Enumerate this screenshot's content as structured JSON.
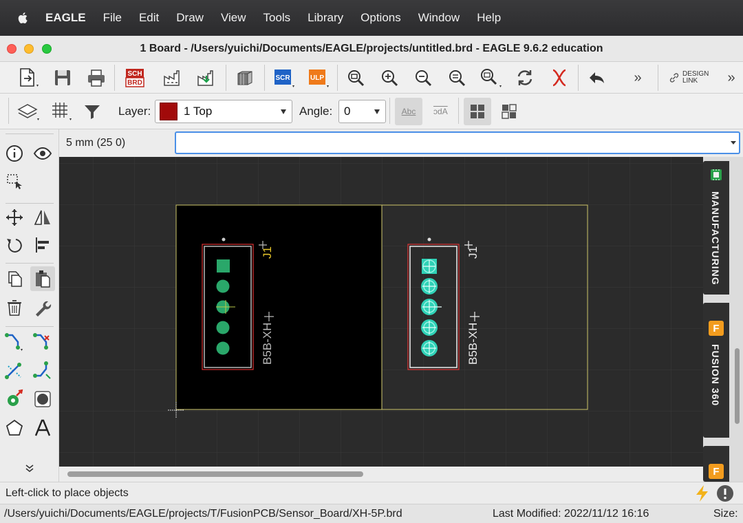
{
  "menubar": {
    "app_name": "EAGLE",
    "items": [
      "File",
      "Edit",
      "Draw",
      "View",
      "Tools",
      "Library",
      "Options",
      "Window",
      "Help"
    ]
  },
  "window": {
    "title": "1 Board - /Users/yuichi/Documents/EAGLE/projects/untitled.brd - EAGLE 9.6.2 education"
  },
  "toolbar1": {
    "sch_brd_top": "SCH",
    "sch_brd_bottom": "BRD",
    "scr_label": "SCR",
    "ulp_label": "ULP",
    "design_link": "DESIGN LINK",
    "overflow": "»"
  },
  "toolbar2": {
    "layer_label": "Layer:",
    "layer_value": "1 Top",
    "layer_color": "#a10a0a",
    "angle_label": "Angle:",
    "angle_value": "0",
    "text_btn_1": "Abc",
    "text_btn_2": "Abc"
  },
  "command": {
    "coordinate": "5 mm (25 0)",
    "input_value": ""
  },
  "board": {
    "left_part": {
      "name": "J1",
      "value": "B5B-XH"
    },
    "right_part": {
      "name": "J1",
      "value": "B5B-XH"
    }
  },
  "side_panel": {
    "tab_1": "MANUFACTURING",
    "tab_2": "FUSION 360",
    "fusion_icon_letter": "F"
  },
  "status": {
    "message": "Left-click to place objects"
  },
  "pathbar": {
    "path": "/Users/yuichi/Documents/EAGLE/projects/T/FusionPCB/Sensor_Board/XH-5P.brd",
    "last_modified": "Last Modified: 2022/11/12 16:16",
    "size_label": "Size:"
  }
}
